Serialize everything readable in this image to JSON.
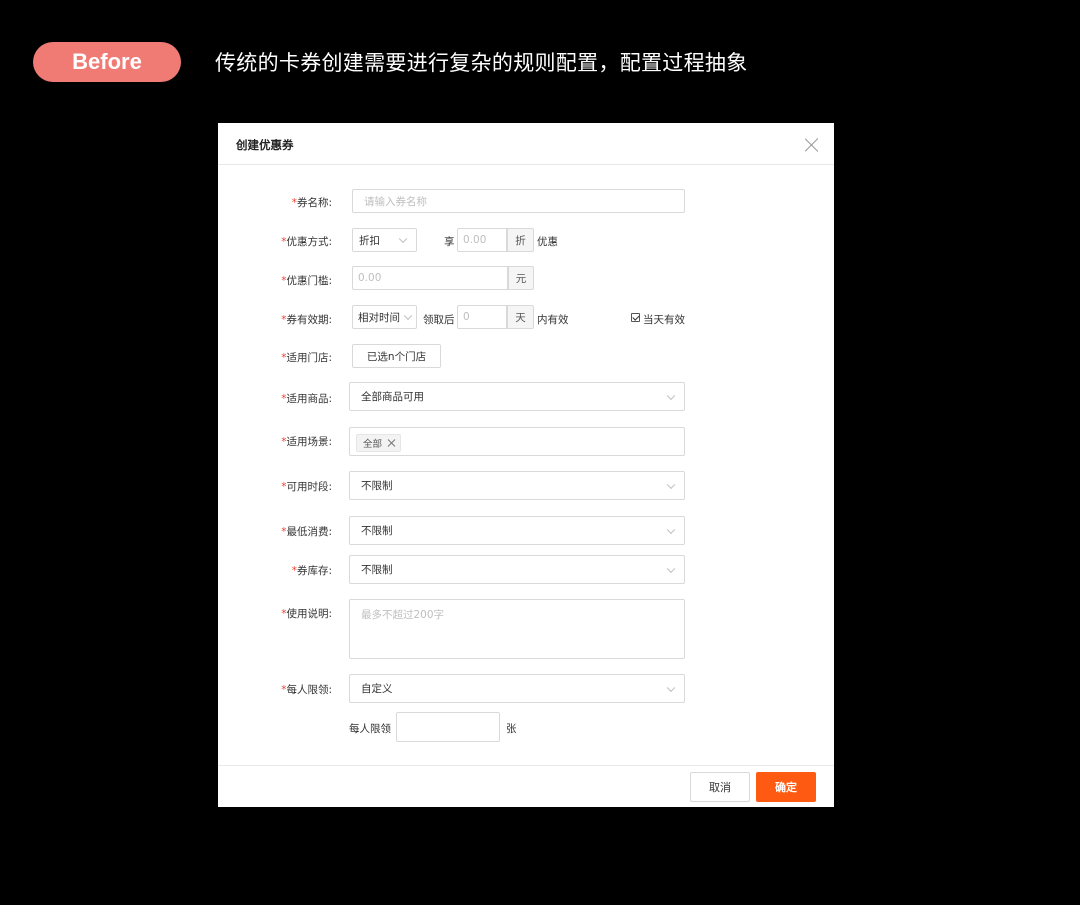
{
  "banner": {
    "pill_label": "Before",
    "headline": "传统的卡券创建需要进行复杂的规则配置，配置过程抽象"
  },
  "dialog": {
    "title": "创建优惠券",
    "fields": {
      "name": {
        "label": "券名称:",
        "placeholder": "请输入券名称"
      },
      "discount": {
        "label": "优惠方式:",
        "select": "折扣",
        "prefix": "享",
        "value": "0.00",
        "unit": "折",
        "suffix": "优惠"
      },
      "threshold": {
        "label": "优惠门槛:",
        "value": "0.00",
        "unit": "元"
      },
      "validity": {
        "label": "券有效期:",
        "select": "相对时间",
        "prefix": "领取后",
        "value": "0",
        "unit": "天",
        "suffix": "内有效",
        "checkbox_label": "当天有效",
        "checkbox_checked": true
      },
      "stores": {
        "label": "适用门店:",
        "button": "已选n个门店"
      },
      "goods": {
        "label": "适用商品:",
        "value": "全部商品可用"
      },
      "scene": {
        "label": "适用场景:",
        "tag": "全部"
      },
      "time": {
        "label": "可用时段:",
        "value": "不限制"
      },
      "min_spend": {
        "label": "最低消费:",
        "value": "不限制"
      },
      "stock": {
        "label": "券库存:",
        "value": "不限制"
      },
      "instructions": {
        "label": "使用说明:",
        "placeholder": "最多不超过200字"
      },
      "limit": {
        "label": "每人限领:",
        "value": "自定义",
        "sub_label": "每人限领",
        "sub_value": "",
        "sub_unit": "张"
      }
    },
    "footer": {
      "cancel": "取消",
      "confirm": "确定"
    }
  },
  "colors": {
    "background": "#000000",
    "pill": "#f07b74",
    "primary": "#ff5a12",
    "required": "#f04134"
  }
}
